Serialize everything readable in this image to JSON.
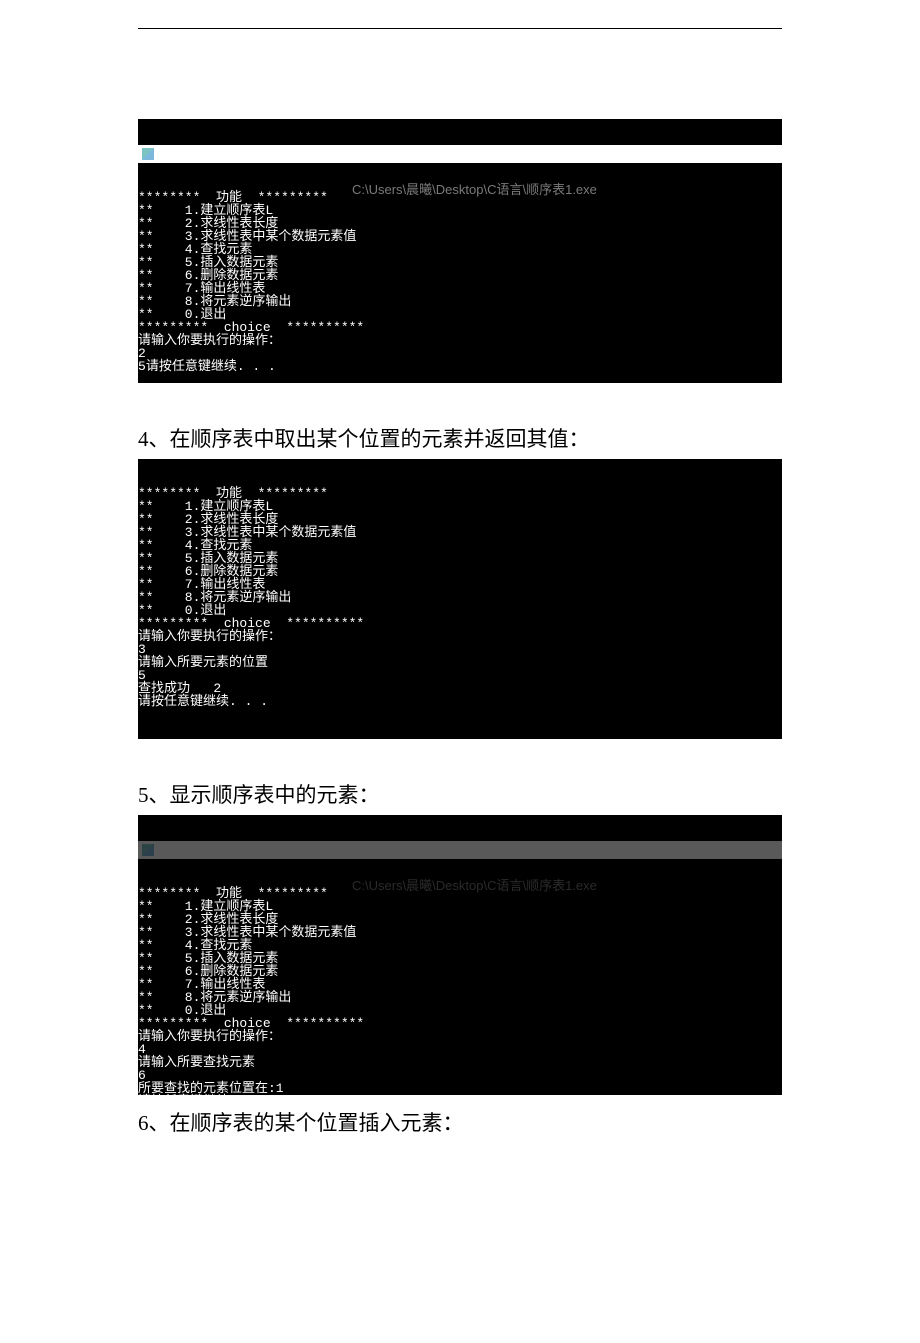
{
  "top_rule": "─",
  "titlebar_path": "C:\\Users\\晨曦\\Desktop\\C语言\\顺序表1.exe",
  "menu_header": "********  功能  *********",
  "menu_items": [
    "**    1.建立顺序表L",
    "**    2.求线性表长度",
    "**    3.求线性表中某个数据元素值",
    "**    4.查找元素",
    "**    5.插入数据元素",
    "**    6.删除数据元素",
    "**    7.输出线性表",
    "**    8.将元素逆序输出",
    "**    0.退出"
  ],
  "choice_header": "*********  choice  **********",
  "prompt_op": "请输入你要执行的操作：",
  "press_any": "请按任意键继续. . .",
  "block1": {
    "input1": "2",
    "output1": "5"
  },
  "heading4": "4、在顺序表中取出某个位置的元素并返回其值：",
  "block2": {
    "input1": "3",
    "prompt_pos": "请输入所要元素的位置",
    "input2": "5",
    "result": "查找成功   2"
  },
  "heading5": "5、显示顺序表中的元素：",
  "block3": {
    "input1": "4",
    "prompt_find": "请输入所要查找元素",
    "input2": "6",
    "result": "所要查找的元素位置在:1"
  },
  "heading6": "6、在顺序表的某个位置插入元素："
}
